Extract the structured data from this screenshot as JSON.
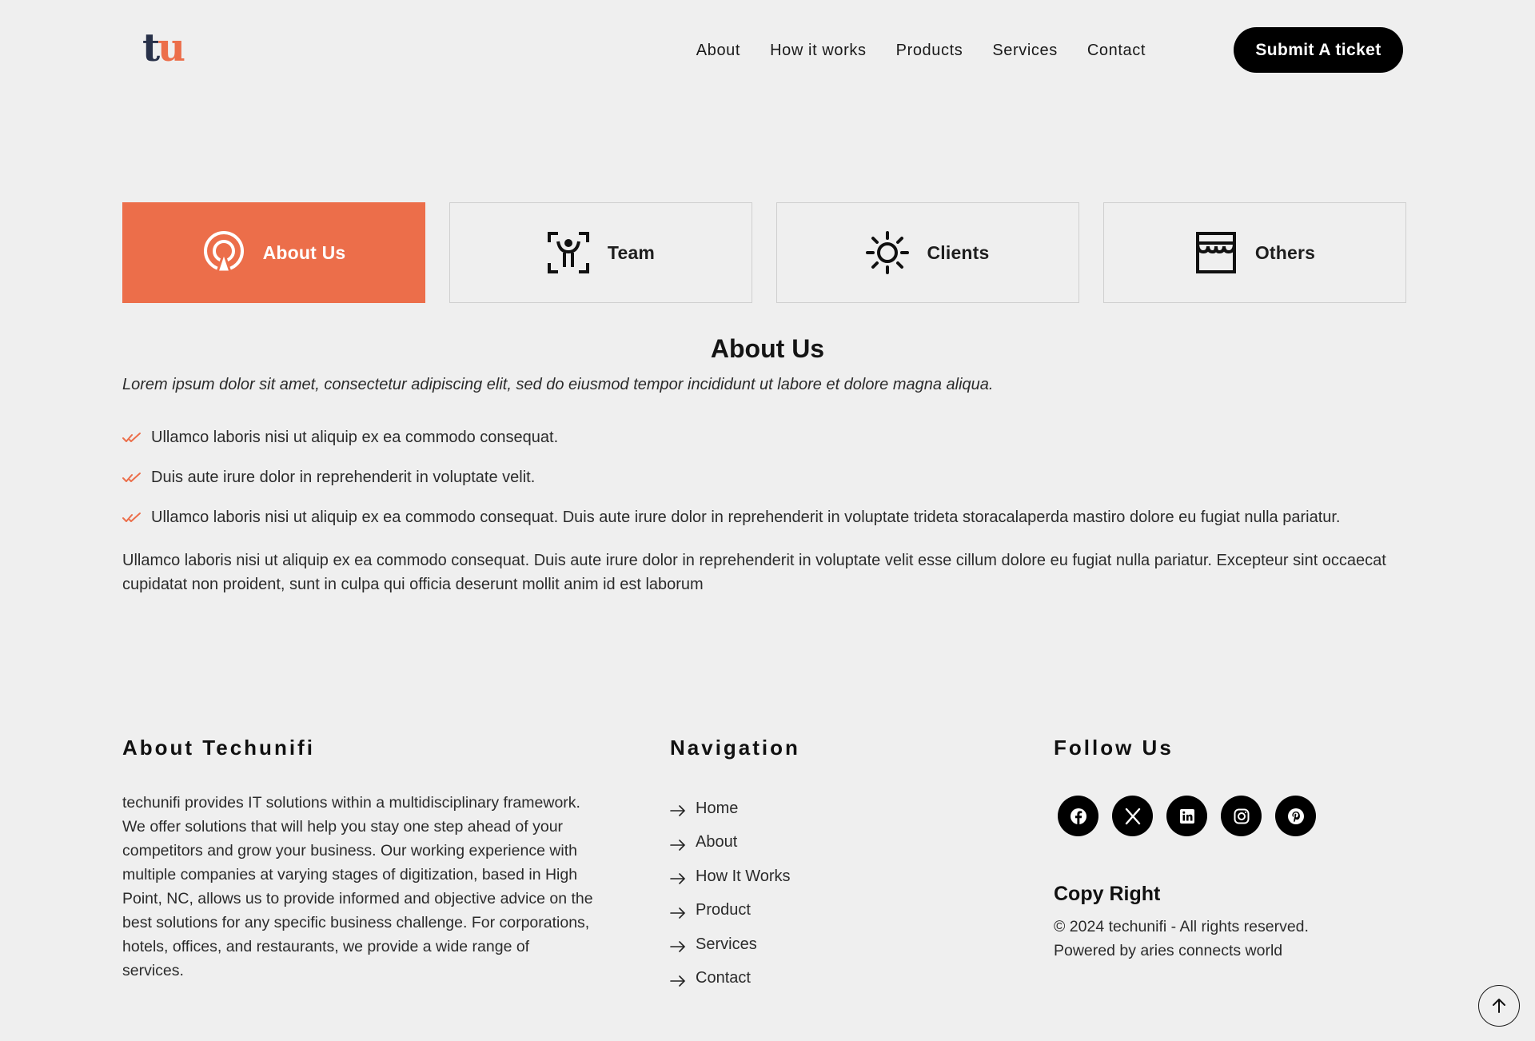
{
  "colors": {
    "accent": "#ec6e4a",
    "background": "#efefef",
    "logo_dark": "#283149"
  },
  "header": {
    "logo": {
      "part1": "t",
      "part2": "u"
    },
    "nav": [
      "About",
      "How it works",
      "Products",
      "Services",
      "Contact"
    ],
    "cta": "Submit A ticket"
  },
  "tabs": [
    {
      "label": "About Us",
      "icon": "radar-icon",
      "active": true
    },
    {
      "label": "Team",
      "icon": "person-scan-icon",
      "active": false
    },
    {
      "label": "Clients",
      "icon": "sun-icon",
      "active": false
    },
    {
      "label": "Others",
      "icon": "store-icon",
      "active": false
    }
  ],
  "content": {
    "title": "About Us",
    "intro": "Lorem ipsum dolor sit amet, consectetur adipiscing elit, sed do eiusmod tempor incididunt ut labore et dolore magna aliqua.",
    "checklist": [
      "Ullamco laboris nisi ut aliquip ex ea commodo consequat.",
      "Duis aute irure dolor in reprehenderit in voluptate velit.",
      "Ullamco laboris nisi ut aliquip ex ea commodo consequat. Duis aute irure dolor in reprehenderit in voluptate trideta storacalaperda mastiro dolore eu fugiat nulla pariatur."
    ],
    "paragraph": "Ullamco laboris nisi ut aliquip ex ea commodo consequat. Duis aute irure dolor in reprehenderit in voluptate velit esse cillum dolore eu fugiat nulla pariatur. Excepteur sint occaecat cupidatat non proident, sunt in culpa qui officia deserunt mollit anim id est laborum"
  },
  "footer": {
    "about": {
      "heading": "About Techunifi",
      "text": "techunifi provides IT solutions within a multidisciplinary framework. We offer solutions that will help you stay one step ahead of your competitors and grow your business. Our working experience with multiple companies at varying stages of digitization, based in High Point, NC, allows us to provide informed and objective advice on the best solutions for any specific business challenge. For corporations, hotels, offices, and restaurants, we provide a wide range of services."
    },
    "navigation": {
      "heading": "Navigation",
      "links": [
        "Home",
        "About",
        "How It Works",
        "Product",
        "Services",
        "Contact"
      ]
    },
    "follow": {
      "heading": "Follow Us",
      "socials": [
        "facebook-icon",
        "x-icon",
        "linkedin-icon",
        "instagram-icon",
        "pinterest-icon"
      ]
    },
    "copyright": {
      "heading": "Copy Right",
      "line1": "© 2024 techunifi - All rights reserved.",
      "line2": "Powered by aries connects world"
    }
  }
}
